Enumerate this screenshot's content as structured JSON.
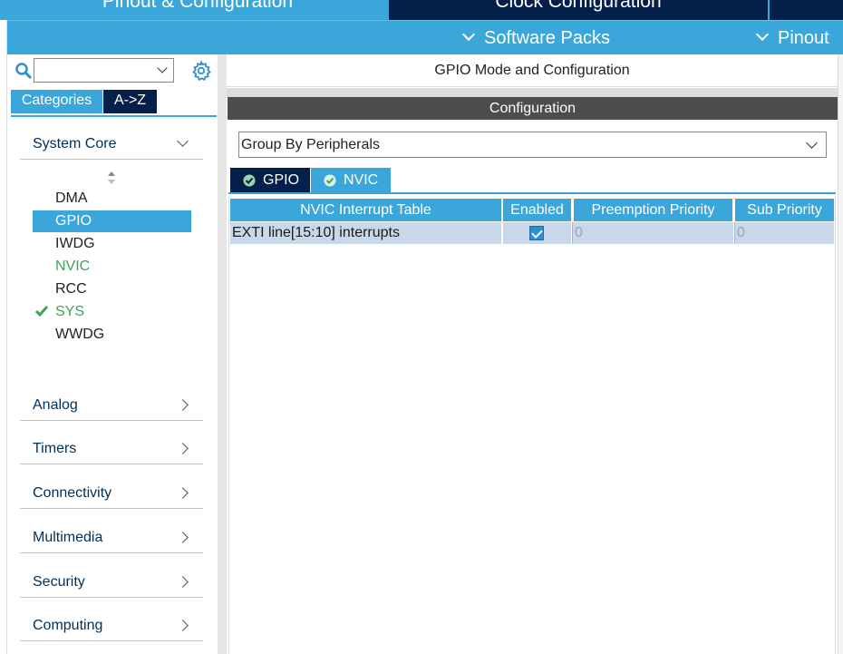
{
  "top_tabs": {
    "pinout_config": "Pinout & Configuration",
    "clock_config": "Clock Configuration"
  },
  "sub_menu": {
    "software_packs": "Software Packs",
    "pinout": "Pinout"
  },
  "left_panel": {
    "search": {
      "value": "",
      "placeholder": ""
    },
    "tabs": {
      "categories": "Categories",
      "az": "A->Z"
    },
    "groups": {
      "system_core": "System Core",
      "analog": "Analog",
      "timers": "Timers",
      "connectivity": "Connectivity",
      "multimedia": "Multimedia",
      "security": "Security",
      "computing": "Computing"
    },
    "peripherals": [
      {
        "label": "DMA",
        "state": "normal"
      },
      {
        "label": "GPIO",
        "state": "selected"
      },
      {
        "label": "IWDG",
        "state": "normal"
      },
      {
        "label": "NVIC",
        "state": "configured"
      },
      {
        "label": "RCC",
        "state": "normal"
      },
      {
        "label": "SYS",
        "state": "checked"
      },
      {
        "label": "WWDG",
        "state": "normal"
      }
    ]
  },
  "right_panel": {
    "mode_title": "GPIO Mode and Configuration",
    "config_title": "Configuration",
    "group_by": "Group By Peripherals",
    "tabs": {
      "gpio": "GPIO",
      "nvic": "NVIC"
    },
    "table": {
      "headers": [
        "NVIC Interrupt Table",
        "Enabled",
        "Preemption Priority",
        "Sub Priority"
      ],
      "rows": [
        {
          "name": "EXTI line[15:10] interrupts",
          "enabled": true,
          "preemption": "0",
          "sub": "0"
        }
      ]
    }
  },
  "colors": {
    "accent_blue": "#3aa6d9",
    "dark_navy": "#04204a",
    "green": "#3aa657",
    "row_selected": "#c9d7ea"
  }
}
